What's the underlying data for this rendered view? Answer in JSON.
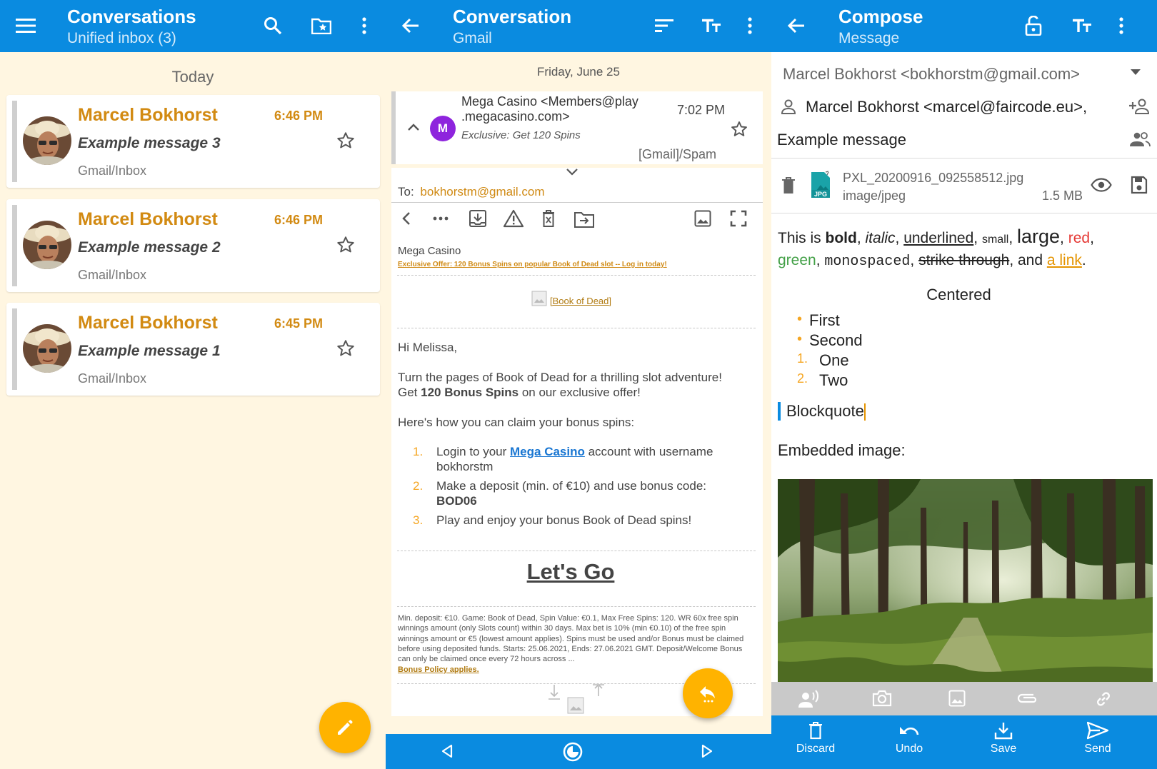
{
  "panel1": {
    "title": "Conversations",
    "subtitle": "Unified inbox (3)",
    "date_header": "Today",
    "messages": [
      {
        "from": "Marcel Bokhorst",
        "time": "6:46 PM",
        "subject": "Example message 3",
        "folder": "Gmail/Inbox"
      },
      {
        "from": "Marcel Bokhorst",
        "time": "6:46 PM",
        "subject": "Example message 2",
        "folder": "Gmail/Inbox"
      },
      {
        "from": "Marcel Bokhorst",
        "time": "6:45 PM",
        "subject": "Example message 1",
        "folder": "Gmail/Inbox"
      }
    ],
    "icons": [
      "menu-icon",
      "search-icon",
      "folder-star-icon",
      "more-vert-icon",
      "star-outline-icon",
      "pencil-icon"
    ]
  },
  "panel2": {
    "title": "Conversation",
    "subtitle": "Gmail",
    "date_header": "Friday, June 25",
    "avatar_letter": "M",
    "sender_line1": "Mega Casino <Members@play",
    "sender_line2": ".megacasino.com>",
    "time": "7:02 PM",
    "snippet": "Exclusive: Get 120 Spins",
    "folder": "[Gmail]/Spam",
    "to_label": "To:",
    "to_value": "bokhorstm@gmail.com",
    "sender_name": "Mega Casino",
    "promo_link": "Exclusive Offer: 120 Bonus Spins on popular Book of Dead slot -- Log in today!",
    "image_alt": "[Book of Dead]",
    "greeting": "Hi Melissa,",
    "para1_line1": "Turn the pages of Book of Dead for a thrilling slot adventure!",
    "para1_line2_pre": "Get ",
    "para1_line2_bold": "120 Bonus Spins",
    "para1_line2_post": " on our exclusive offer!",
    "para2": "Here's how you can claim your bonus spins:",
    "steps": [
      {
        "n": "1.",
        "pre": "Login to your ",
        "link": "Mega Casino",
        "post": " account with username bokhorstm",
        "bold": ""
      },
      {
        "n": "2.",
        "pre": "Make a deposit (min. of €10) and use bonus code: ",
        "link": "",
        "post": "",
        "bold": "BOD06"
      },
      {
        "n": "3.",
        "pre": "Play and enjoy your bonus Book of Dead spins!",
        "link": "",
        "post": "",
        "bold": ""
      }
    ],
    "cta": "Let's Go",
    "fine_print": "Min. deposit: €10. Game: Book of Dead, Spin Value: €0.1, Max Free Spins: 120. WR 60x free spin winnings amount (only Slots count) within 30 days. Max bet is 10% (min €0.10) of the free spin winnings amount or €5 (lowest amount applies). Spins must be used and/or Bonus must be claimed before using deposited funds. Starts: 25.06.2021, Ends: 27.06.2021 GMT. Deposit/Welcome Bonus can only be claimed once every 72 hours across ...",
    "bonus_policy": "Bonus Policy applies.",
    "icons": [
      "back-arrow-icon",
      "sort-icon",
      "text-size-icon",
      "more-vert-icon",
      "chevron-up-icon",
      "star-outline-icon",
      "expand-more-icon",
      "nav-back-icon",
      "more-horiz-icon",
      "archive-icon",
      "report-spam-icon",
      "delete-icon",
      "move-icon",
      "image-icon",
      "fullscreen-icon",
      "reply-icon",
      "prev-icon",
      "home-icon",
      "next-icon"
    ]
  },
  "panel3": {
    "title": "Compose",
    "subtitle": "Message",
    "from": "Marcel Bokhorst <bokhorstm@gmail.com>",
    "to": "Marcel Bokhorst <marcel@faircode.eu>,",
    "subject": "Example message",
    "attachment": {
      "name": "PXL_20200916_092558512.jpg",
      "type": "image/jpeg",
      "size": "1.5 MB",
      "badge": "JPG"
    },
    "rich": {
      "pre": "This is ",
      "bold": "bold",
      "c1": ", ",
      "italic": "italic",
      "c2": ", ",
      "underlined": "underlined",
      "c3": ", ",
      "small": "small",
      "c4": ", ",
      "large": "large",
      "c5": ", ",
      "red": "red",
      "c6": ",",
      "green": "green",
      "c7": ", ",
      "mono": "monospaced",
      "c8": ", ",
      "strike": "strike through",
      "c9": ", and ",
      "link": "a link",
      "end": "."
    },
    "centered": "Centered",
    "bullets": [
      "First",
      "Second"
    ],
    "numbered": [
      {
        "n": "1.",
        "t": "One"
      },
      {
        "n": "2.",
        "t": "Two"
      }
    ],
    "blockquote": "Blockquote",
    "embedded_label": "Embedded image:",
    "actions": {
      "discard": "Discard",
      "undo": "Undo",
      "save": "Save",
      "send": "Send"
    },
    "colors": {
      "red": "#e53935",
      "green": "#43a047",
      "link": "#e59400",
      "accent": "#0a8be0"
    }
  }
}
